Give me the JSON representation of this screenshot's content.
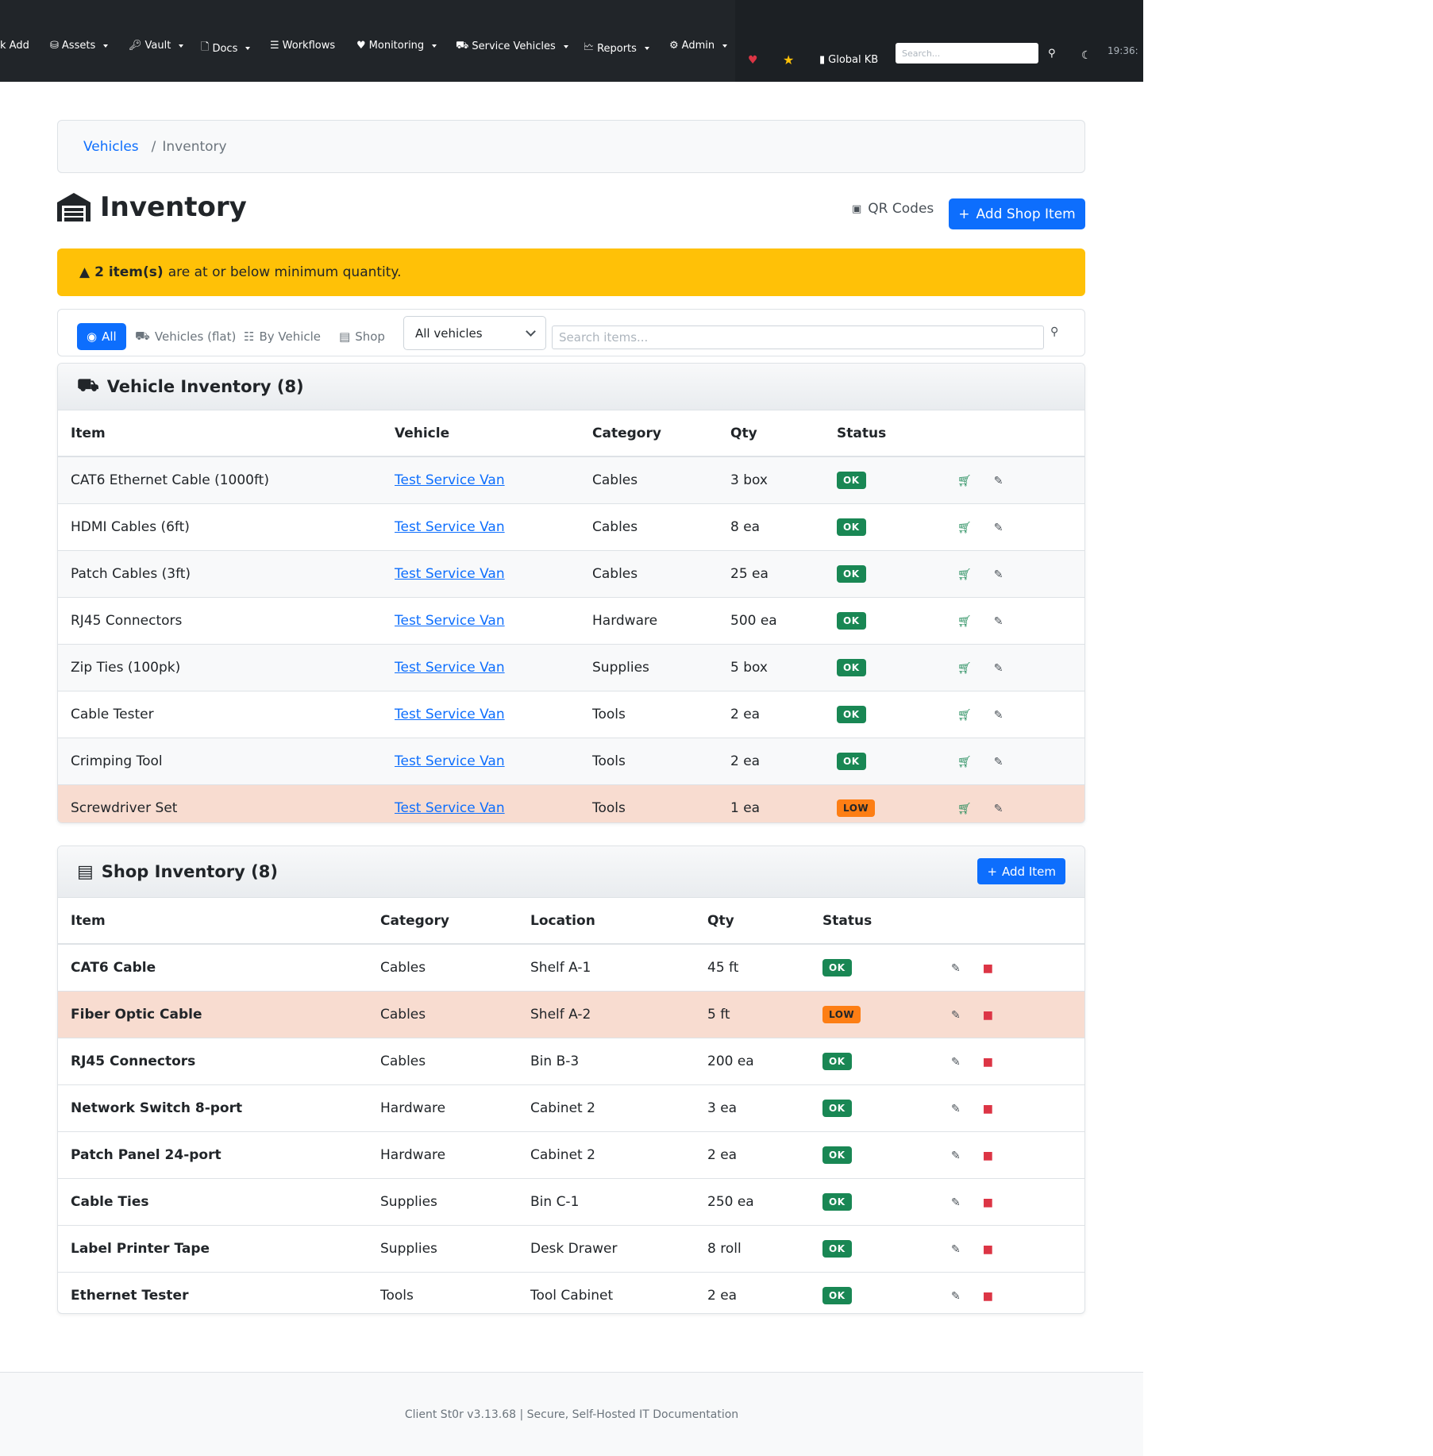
{
  "nav": {
    "items": [
      "k Add",
      "Assets",
      "Vault",
      "Docs",
      "Workflows",
      "Monitoring",
      "Service Vehicles",
      "Reports",
      "Admin"
    ],
    "global_kb": "Global KB",
    "search_placeholder": "Search...",
    "clock": "19:36:"
  },
  "breadcrumb": {
    "parent": "Vehicles",
    "separator": "/",
    "current": "Inventory"
  },
  "page": {
    "title": "Inventory",
    "qr_label": "QR Codes",
    "add_shop_label": "Add Shop Item"
  },
  "alert": {
    "count_text": "2 item(s)",
    "rest_text": "are at or below minimum quantity."
  },
  "filters": {
    "all": "All",
    "vehicles_flat": "Vehicles (flat)",
    "by_vehicle": "By Vehicle",
    "shop": "Shop",
    "select_value": "All vehicles",
    "search_placeholder": "Search items..."
  },
  "vehicle_inventory": {
    "title": "Vehicle Inventory (8)",
    "headers": [
      "Item",
      "Vehicle",
      "Category",
      "Qty",
      "Status"
    ],
    "rows": [
      {
        "item": "CAT6 Ethernet Cable (1000ft)",
        "vehicle": "Test Service Van",
        "category": "Cables",
        "qty": "3 box",
        "status": "OK"
      },
      {
        "item": "HDMI Cables (6ft)",
        "vehicle": "Test Service Van",
        "category": "Cables",
        "qty": "8 ea",
        "status": "OK"
      },
      {
        "item": "Patch Cables (3ft)",
        "vehicle": "Test Service Van",
        "category": "Cables",
        "qty": "25 ea",
        "status": "OK"
      },
      {
        "item": "RJ45 Connectors",
        "vehicle": "Test Service Van",
        "category": "Hardware",
        "qty": "500 ea",
        "status": "OK"
      },
      {
        "item": "Zip Ties (100pk)",
        "vehicle": "Test Service Van",
        "category": "Supplies",
        "qty": "5 box",
        "status": "OK"
      },
      {
        "item": "Cable Tester",
        "vehicle": "Test Service Van",
        "category": "Tools",
        "qty": "2 ea",
        "status": "OK"
      },
      {
        "item": "Crimping Tool",
        "vehicle": "Test Service Van",
        "category": "Tools",
        "qty": "2 ea",
        "status": "OK"
      },
      {
        "item": "Screwdriver Set",
        "vehicle": "Test Service Van",
        "category": "Tools",
        "qty": "1 ea",
        "status": "LOW"
      }
    ]
  },
  "shop_inventory": {
    "title": "Shop Inventory (8)",
    "add_label": "Add Item",
    "headers": [
      "Item",
      "Category",
      "Location",
      "Qty",
      "Status"
    ],
    "rows": [
      {
        "item": "CAT6 Cable",
        "category": "Cables",
        "location": "Shelf A-1",
        "qty": "45 ft",
        "status": "OK"
      },
      {
        "item": "Fiber Optic Cable",
        "category": "Cables",
        "location": "Shelf A-2",
        "qty": "5 ft",
        "status": "LOW"
      },
      {
        "item": "RJ45 Connectors",
        "category": "Cables",
        "location": "Bin B-3",
        "qty": "200 ea",
        "status": "OK"
      },
      {
        "item": "Network Switch 8-port",
        "category": "Hardware",
        "location": "Cabinet 2",
        "qty": "3 ea",
        "status": "OK"
      },
      {
        "item": "Patch Panel 24-port",
        "category": "Hardware",
        "location": "Cabinet 2",
        "qty": "2 ea",
        "status": "OK"
      },
      {
        "item": "Cable Ties",
        "category": "Supplies",
        "location": "Bin C-1",
        "qty": "250 ea",
        "status": "OK"
      },
      {
        "item": "Label Printer Tape",
        "category": "Supplies",
        "location": "Desk Drawer",
        "qty": "8 roll",
        "status": "OK"
      },
      {
        "item": "Ethernet Tester",
        "category": "Tools",
        "location": "Tool Cabinet",
        "qty": "2 ea",
        "status": "OK"
      }
    ]
  },
  "footer": {
    "text": "Client St0r v3.13.68 | Secure, Self-Hosted IT Documentation"
  },
  "colors": {
    "nav_bg": "#212529",
    "primary": "#0d6efd",
    "warning": "#ffc107",
    "ok": "#198754",
    "low": "#fd7e14",
    "low_row": "#f8dcd0",
    "danger": "#dc3545"
  }
}
